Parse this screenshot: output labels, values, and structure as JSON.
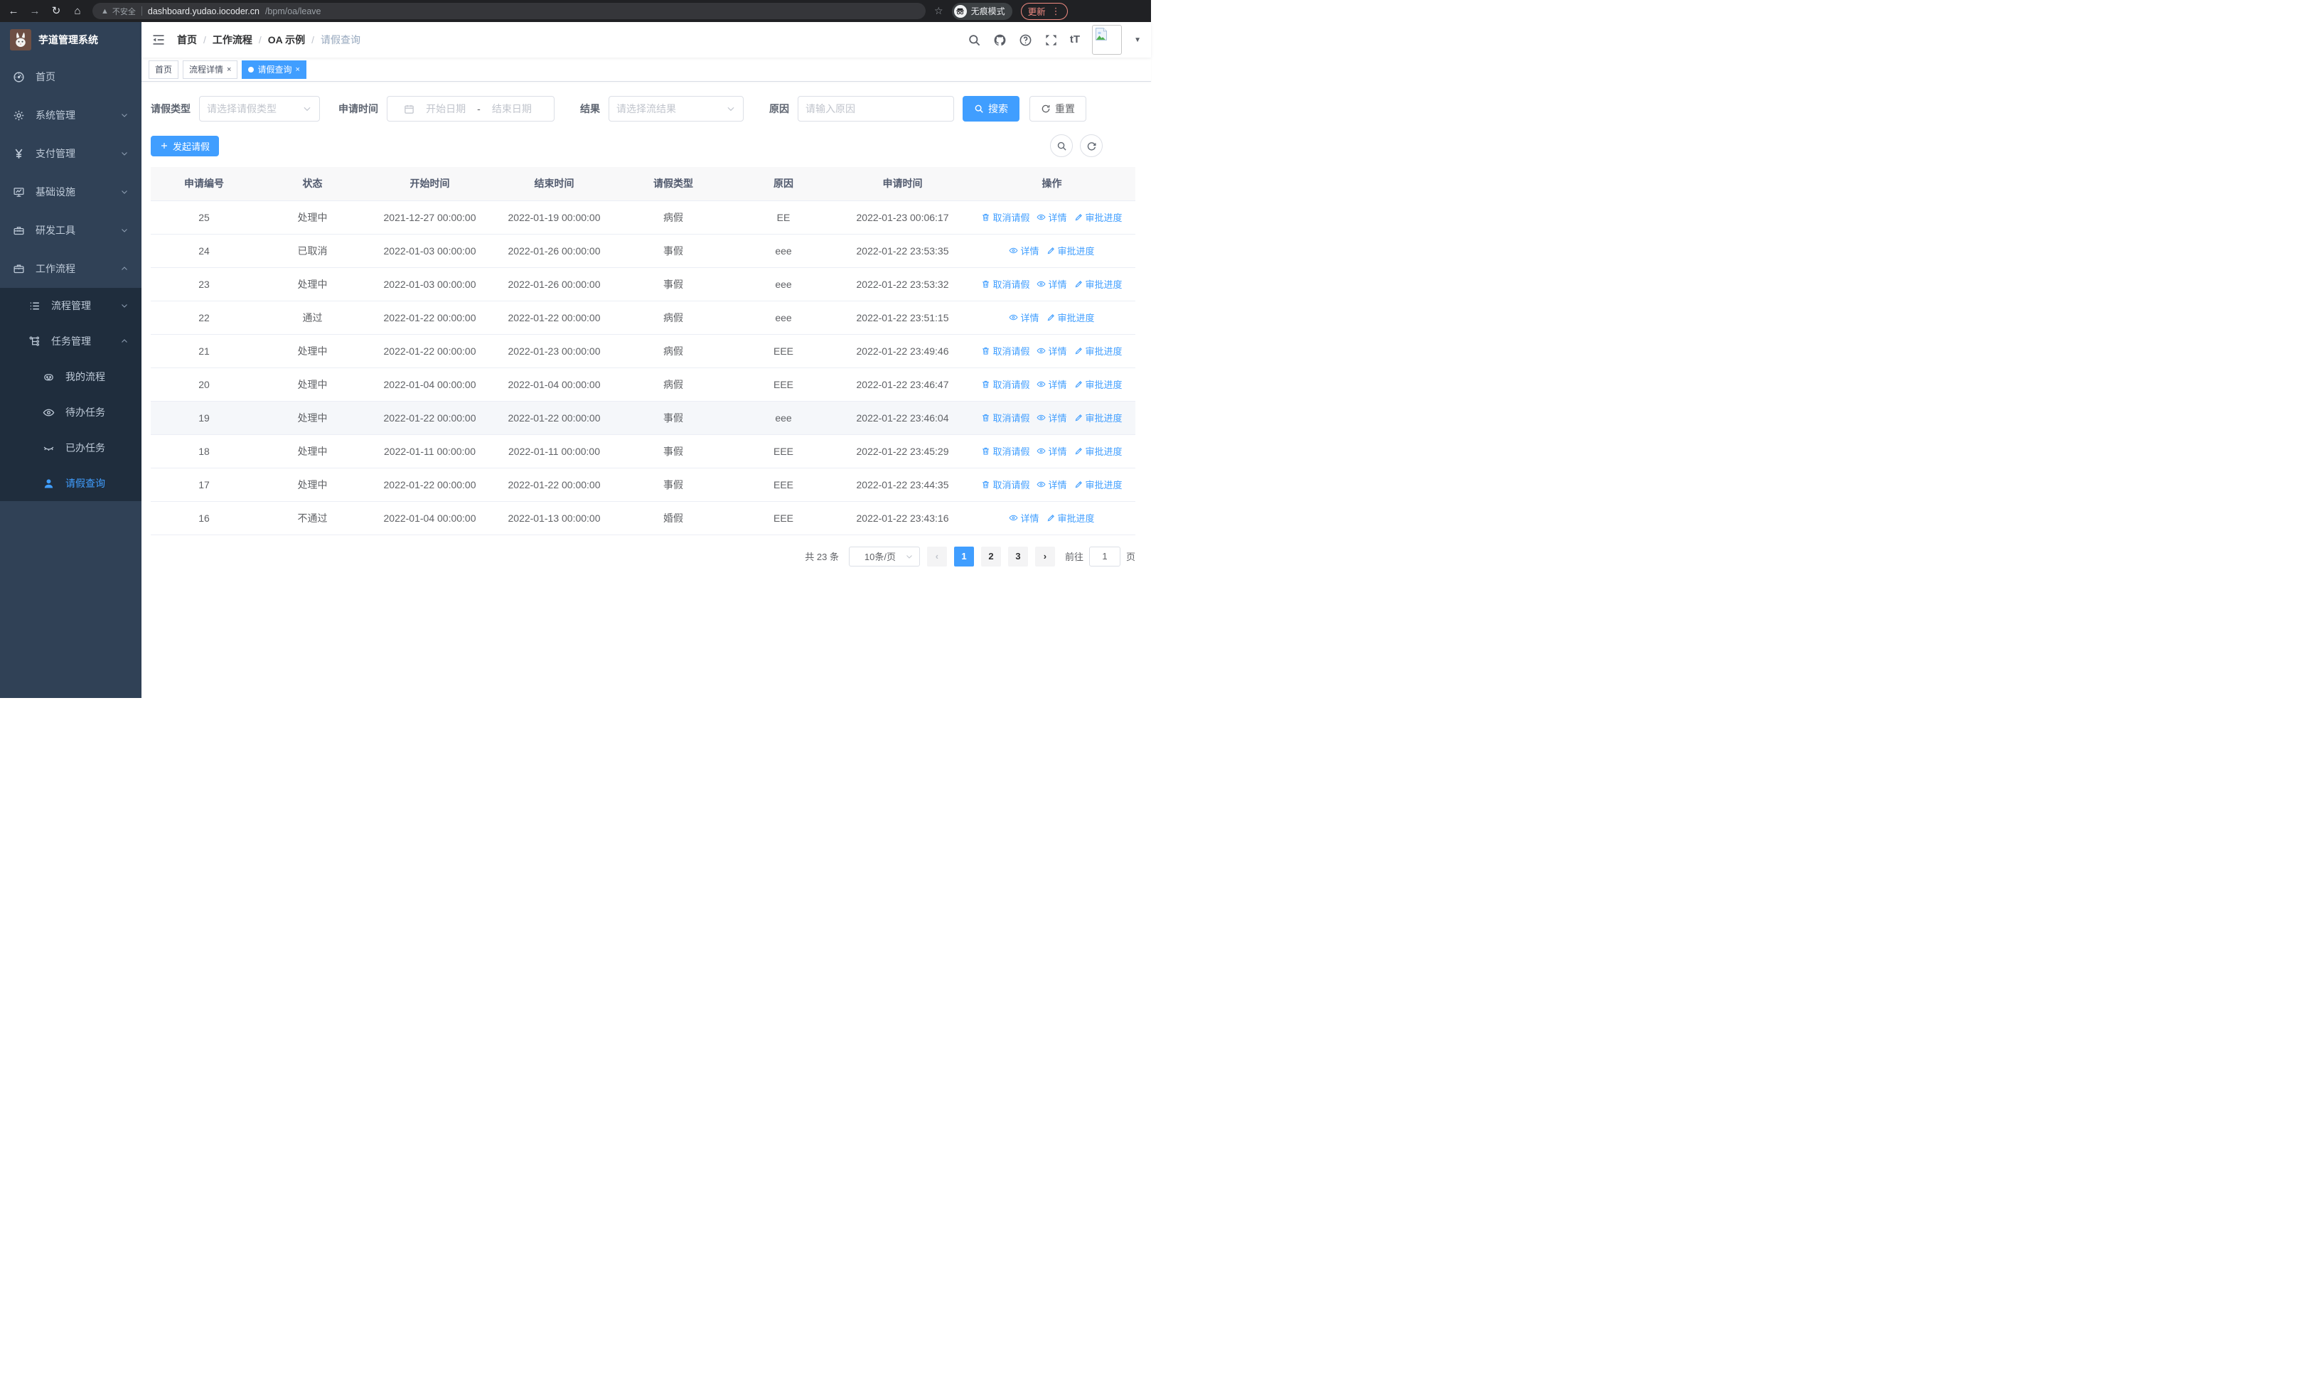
{
  "colors": {
    "accent": "#409eff",
    "sidebar_bg": "#304156",
    "submenu_bg": "#1f2d3d",
    "update_pill": "#f28b82"
  },
  "browser": {
    "security_label": "不安全",
    "url_host": "dashboard.yudao.iocoder.cn",
    "url_path": "/bpm/oa/leave",
    "incognito_label": "无痕模式",
    "update_label": "更新"
  },
  "sidebar": {
    "title": "芋道管理系统",
    "items": [
      {
        "icon": "dashboard",
        "label": "首页"
      },
      {
        "icon": "gear",
        "label": "系统管理",
        "arrow": "down"
      },
      {
        "icon": "yen",
        "label": "支付管理",
        "arrow": "down"
      },
      {
        "icon": "monitor",
        "label": "基础设施",
        "arrow": "down"
      },
      {
        "icon": "toolbox",
        "label": "研发工具",
        "arrow": "down"
      },
      {
        "icon": "briefcase",
        "label": "工作流程",
        "arrow": "up"
      }
    ],
    "workflow_submenu": [
      {
        "icon": "list",
        "label": "流程管理",
        "arrow": "down",
        "level": 2
      },
      {
        "icon": "tree",
        "label": "任务管理",
        "arrow": "up",
        "level": 2
      },
      {
        "icon": "robot",
        "label": "我的流程",
        "level": 3
      },
      {
        "icon": "eye",
        "label": "待办任务",
        "level": 3
      },
      {
        "icon": "eye-closed",
        "label": "已办任务",
        "level": 3
      },
      {
        "icon": "user",
        "label": "请假查询",
        "level": 3,
        "active": true
      }
    ]
  },
  "breadcrumb": [
    "首页",
    "工作流程",
    "OA 示例",
    "请假查询"
  ],
  "tabs": [
    {
      "label": "首页",
      "closable": false,
      "active": false
    },
    {
      "label": "流程详情",
      "closable": true,
      "active": false
    },
    {
      "label": "请假查询",
      "closable": true,
      "active": true
    }
  ],
  "filters": {
    "leave_type_label": "请假类型",
    "leave_type_placeholder": "请选择请假类型",
    "apply_time_label": "申请时间",
    "start_placeholder": "开始日期",
    "range_separator": "-",
    "end_placeholder": "结束日期",
    "result_label": "结果",
    "result_placeholder": "请选择流结果",
    "reason_label": "原因",
    "reason_placeholder": "请输入原因",
    "search_label": "搜索",
    "reset_label": "重置"
  },
  "toolbar": {
    "create_label": "发起请假"
  },
  "table": {
    "columns": [
      "申请编号",
      "状态",
      "开始时间",
      "结束时间",
      "请假类型",
      "原因",
      "申请时间",
      "操作"
    ],
    "action_labels": {
      "cancel": "取消请假",
      "detail": "详情",
      "progress": "审批进度"
    },
    "rows": [
      {
        "id": "25",
        "status": "处理中",
        "start": "2021-12-27 00:00:00",
        "end": "2022-01-19 00:00:00",
        "type": "病假",
        "reason": "EE",
        "apply_time": "2022-01-23 00:06:17",
        "actions": [
          "cancel",
          "detail",
          "progress"
        ],
        "highlight": false
      },
      {
        "id": "24",
        "status": "已取消",
        "start": "2022-01-03 00:00:00",
        "end": "2022-01-26 00:00:00",
        "type": "事假",
        "reason": "eee",
        "apply_time": "2022-01-22 23:53:35",
        "actions": [
          "detail",
          "progress"
        ],
        "highlight": false
      },
      {
        "id": "23",
        "status": "处理中",
        "start": "2022-01-03 00:00:00",
        "end": "2022-01-26 00:00:00",
        "type": "事假",
        "reason": "eee",
        "apply_time": "2022-01-22 23:53:32",
        "actions": [
          "cancel",
          "detail",
          "progress"
        ],
        "highlight": false
      },
      {
        "id": "22",
        "status": "通过",
        "start": "2022-01-22 00:00:00",
        "end": "2022-01-22 00:00:00",
        "type": "病假",
        "reason": "eee",
        "apply_time": "2022-01-22 23:51:15",
        "actions": [
          "detail",
          "progress"
        ],
        "highlight": false
      },
      {
        "id": "21",
        "status": "处理中",
        "start": "2022-01-22 00:00:00",
        "end": "2022-01-23 00:00:00",
        "type": "病假",
        "reason": "EEE",
        "apply_time": "2022-01-22 23:49:46",
        "actions": [
          "cancel",
          "detail",
          "progress"
        ],
        "highlight": false
      },
      {
        "id": "20",
        "status": "处理中",
        "start": "2022-01-04 00:00:00",
        "end": "2022-01-04 00:00:00",
        "type": "病假",
        "reason": "EEE",
        "apply_time": "2022-01-22 23:46:47",
        "actions": [
          "cancel",
          "detail",
          "progress"
        ],
        "highlight": false
      },
      {
        "id": "19",
        "status": "处理中",
        "start": "2022-01-22 00:00:00",
        "end": "2022-01-22 00:00:00",
        "type": "事假",
        "reason": "eee",
        "apply_time": "2022-01-22 23:46:04",
        "actions": [
          "cancel",
          "detail",
          "progress"
        ],
        "highlight": true
      },
      {
        "id": "18",
        "status": "处理中",
        "start": "2022-01-11 00:00:00",
        "end": "2022-01-11 00:00:00",
        "type": "事假",
        "reason": "EEE",
        "apply_time": "2022-01-22 23:45:29",
        "actions": [
          "cancel",
          "detail",
          "progress"
        ],
        "highlight": false
      },
      {
        "id": "17",
        "status": "处理中",
        "start": "2022-01-22 00:00:00",
        "end": "2022-01-22 00:00:00",
        "type": "事假",
        "reason": "EEE",
        "apply_time": "2022-01-22 23:44:35",
        "actions": [
          "cancel",
          "detail",
          "progress"
        ],
        "highlight": false
      },
      {
        "id": "16",
        "status": "不通过",
        "start": "2022-01-04 00:00:00",
        "end": "2022-01-13 00:00:00",
        "type": "婚假",
        "reason": "EEE",
        "apply_time": "2022-01-22 23:43:16",
        "actions": [
          "detail",
          "progress"
        ],
        "highlight": false
      }
    ]
  },
  "pagination": {
    "total_text": "共 23 条",
    "page_size_text": "10条/页",
    "pages": [
      "1",
      "2",
      "3"
    ],
    "active_page": "1",
    "goto_label": "前往",
    "goto_value": "1",
    "goto_suffix": "页"
  }
}
